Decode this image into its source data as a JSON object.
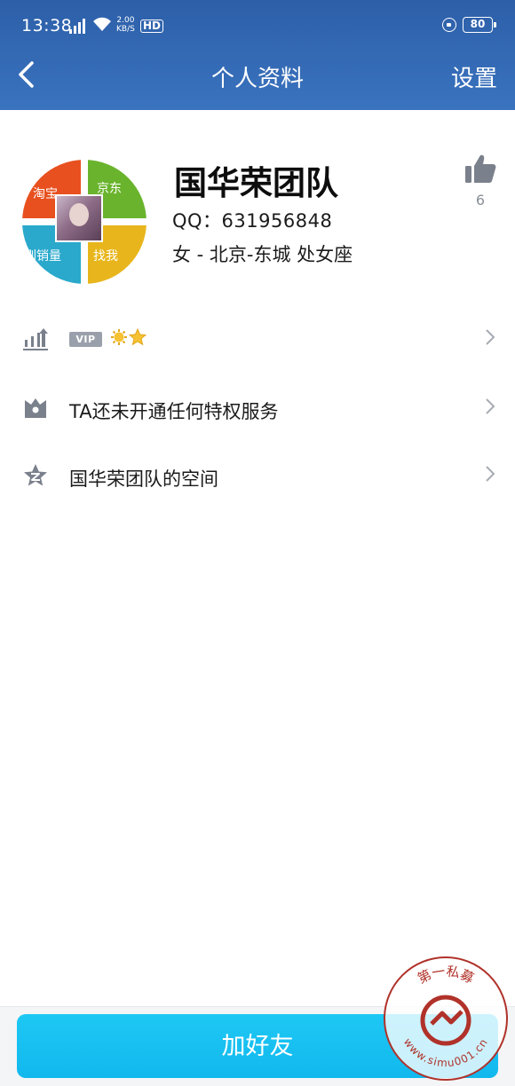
{
  "status_bar": {
    "time": "13:38",
    "network_type": "4G",
    "speed_value": "2.00",
    "speed_unit": "KB/S",
    "hd": "HD",
    "battery": "80"
  },
  "nav": {
    "title": "个人资料",
    "settings_label": "设置"
  },
  "profile": {
    "name": "国华荣团队",
    "qq": "QQ：631956848",
    "info": "女  -  北京-东城  处女座",
    "likes": "6",
    "avatar_labels": [
      "淘宝",
      "京东",
      "刷销量",
      "找我"
    ]
  },
  "rows": [
    {
      "icon": "level-chart-icon",
      "badge": "VIP"
    },
    {
      "icon": "crown-privilege-icon",
      "label": "TA还未开通任何特权服务"
    },
    {
      "icon": "qzone-star-icon",
      "label": "国华荣团队的空间"
    }
  ],
  "bottom": {
    "add_friend_label": "加好友"
  },
  "watermark": {
    "text_top": "第一私募",
    "text_bottom": "www.simu001.cn"
  },
  "colors": {
    "header": "#3a73bf",
    "button": "#11b8ee",
    "icon_gray": "#8a8f99"
  }
}
